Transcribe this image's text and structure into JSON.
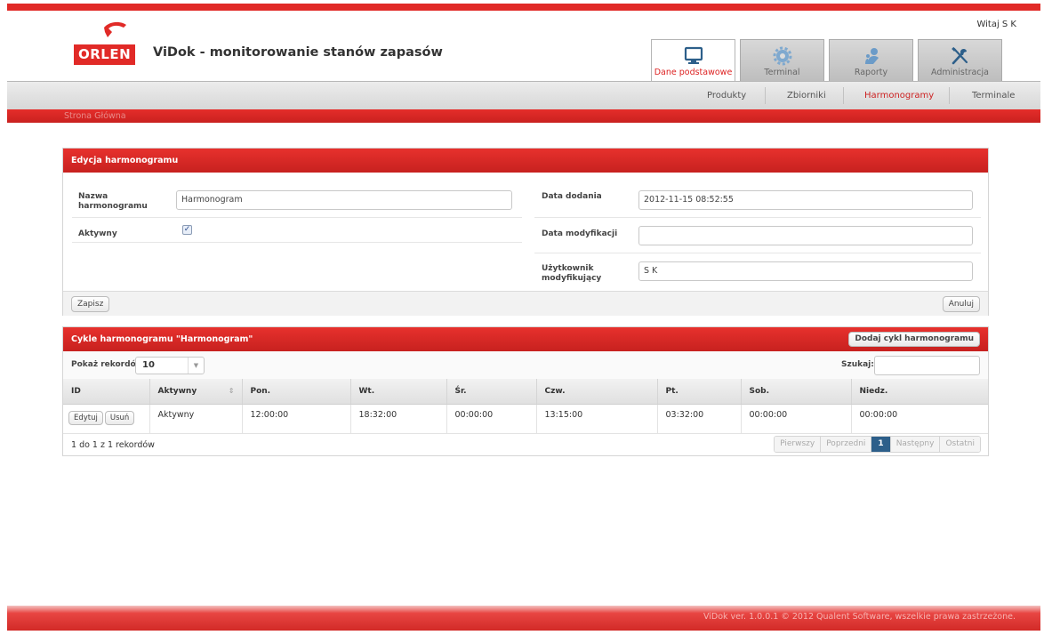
{
  "header": {
    "logo_text": "ORLEN",
    "app_title": "ViDok - monitorowanie stanów zapasów",
    "greeting": "Witaj S K"
  },
  "main_tabs": [
    {
      "label": "Dane podstawowe",
      "icon": "monitor-icon",
      "active": true
    },
    {
      "label": "Terminal",
      "icon": "gear-icon",
      "active": false
    },
    {
      "label": "Raporty",
      "icon": "user-chart-icon",
      "active": false
    },
    {
      "label": "Administracja",
      "icon": "tools-icon",
      "active": false
    }
  ],
  "subnav": {
    "items": [
      "Produkty",
      "Zbiorniki",
      "Harmonogramy",
      "Terminale"
    ],
    "active": "Harmonogramy"
  },
  "breadcrumb": "Strona Główna",
  "edit_panel": {
    "title": "Edycja harmonogramu",
    "name_label": "Nazwa harmonogramu",
    "name_value": "Harmonogram",
    "active_label": "Aktywny",
    "active_checked": true,
    "date_added_label": "Data dodania",
    "date_added_value": "2012-11-15 08:52:55",
    "date_modified_label": "Data modyfikacji",
    "date_modified_value": "",
    "modified_by_label": "Użytkownik modyfikujący",
    "modified_by_value": "S K",
    "save_label": "Zapisz",
    "cancel_label": "Anuluj"
  },
  "cycles_panel": {
    "title": "Cykle harmonogramu \"Harmonogram\"",
    "add_label": "Dodaj cykl harmonogramu",
    "show_label": "Pokaż rekordów",
    "show_value": "10",
    "search_label": "Szukaj:",
    "search_value": "",
    "columns": [
      "ID",
      "Aktywny",
      "Pon.",
      "Wt.",
      "Śr.",
      "Czw.",
      "Pt.",
      "Sob.",
      "Niedz."
    ],
    "rows": [
      {
        "edit_label": "Edytuj",
        "delete_label": "Usuń",
        "active": "Aktywny",
        "mon": "12:00:00",
        "tue": "18:32:00",
        "wed": "00:00:00",
        "thu": "13:15:00",
        "fri": "03:32:00",
        "sat": "00:00:00",
        "sun": "00:00:00"
      }
    ],
    "info": "1 do 1 z 1 rekordów",
    "pager": {
      "first": "Pierwszy",
      "prev": "Poprzedni",
      "current": "1",
      "next": "Następny",
      "last": "Ostatni"
    }
  },
  "footer": "ViDok ver. 1.0.0.1 © 2012 Qualent Software, wszelkie prawa zastrzeżone.",
  "colors": {
    "brand_red": "#e12a27",
    "active_page": "#2d5f8a"
  }
}
